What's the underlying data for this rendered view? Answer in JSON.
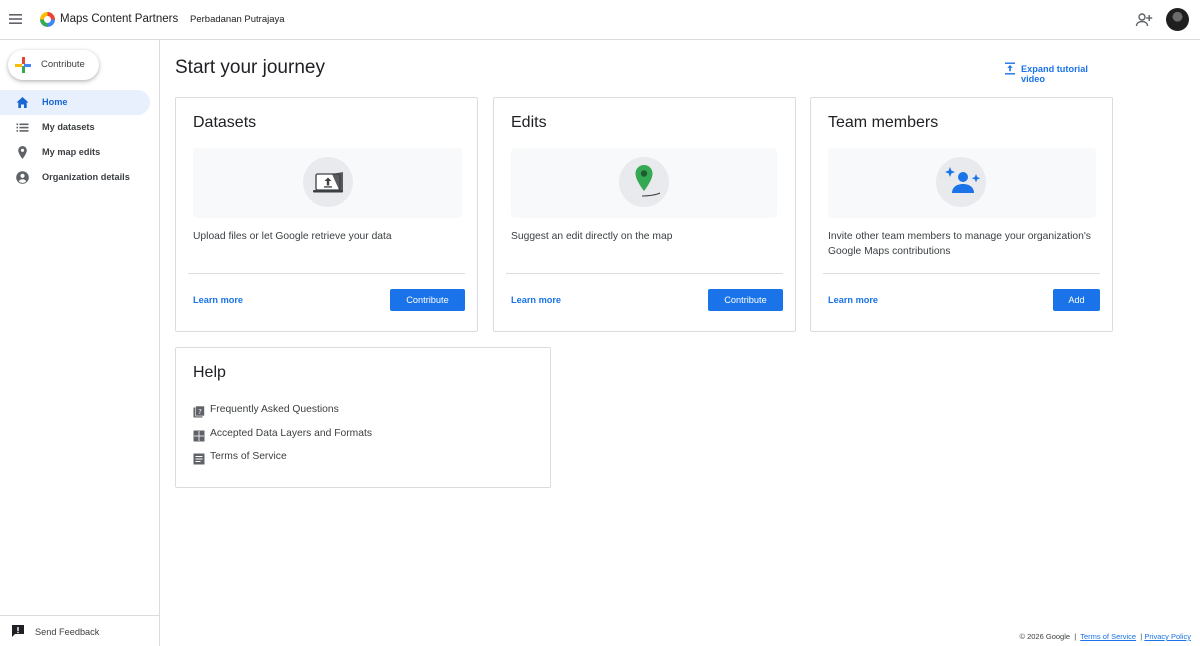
{
  "header": {
    "app_title": "Maps Content Partners",
    "org_name": "Perbadanan Putrajaya"
  },
  "sidebar": {
    "contribute_label": "Contribute",
    "items": [
      {
        "label": "Home",
        "icon": "home-icon",
        "active": true
      },
      {
        "label": "My datasets",
        "icon": "list-icon",
        "active": false
      },
      {
        "label": "My map edits",
        "icon": "location-pin-icon",
        "active": false
      },
      {
        "label": "Organization details",
        "icon": "account-circle-icon",
        "active": false
      }
    ],
    "feedback_label": "Send Feedback"
  },
  "main": {
    "page_title": "Start your journey",
    "expand_video_label": "Expand tutorial video",
    "cards": [
      {
        "title": "Datasets",
        "description": "Upload files or let Google retrieve your data",
        "learn_more": "Learn more",
        "button": "Contribute",
        "illustration": "upload-laptop-icon"
      },
      {
        "title": "Edits",
        "description": "Suggest an edit directly on the map",
        "learn_more": "Learn more",
        "button": "Contribute",
        "illustration": "map-pin-icon"
      },
      {
        "title": "Team members",
        "description": "Invite other team members to manage your organization's Google Maps contributions",
        "learn_more": "Learn more",
        "button": "Add",
        "illustration": "team-sparkle-icon"
      }
    ],
    "help": {
      "title": "Help",
      "links": [
        {
          "label": "Frequently Asked Questions",
          "icon": "faq-icon"
        },
        {
          "label": "Accepted Data Layers and Formats",
          "icon": "grid-icon"
        },
        {
          "label": "Terms of Service",
          "icon": "article-icon"
        }
      ]
    }
  },
  "footer": {
    "copyright": "© 2026 Google",
    "separator": "|",
    "terms": "Terms of Service",
    "privacy": "Privacy Policy"
  },
  "colors": {
    "accent": "#1a73e8",
    "active_nav_bg": "#e8f0fe",
    "border": "#dadce0",
    "pin_green": "#34a853"
  }
}
